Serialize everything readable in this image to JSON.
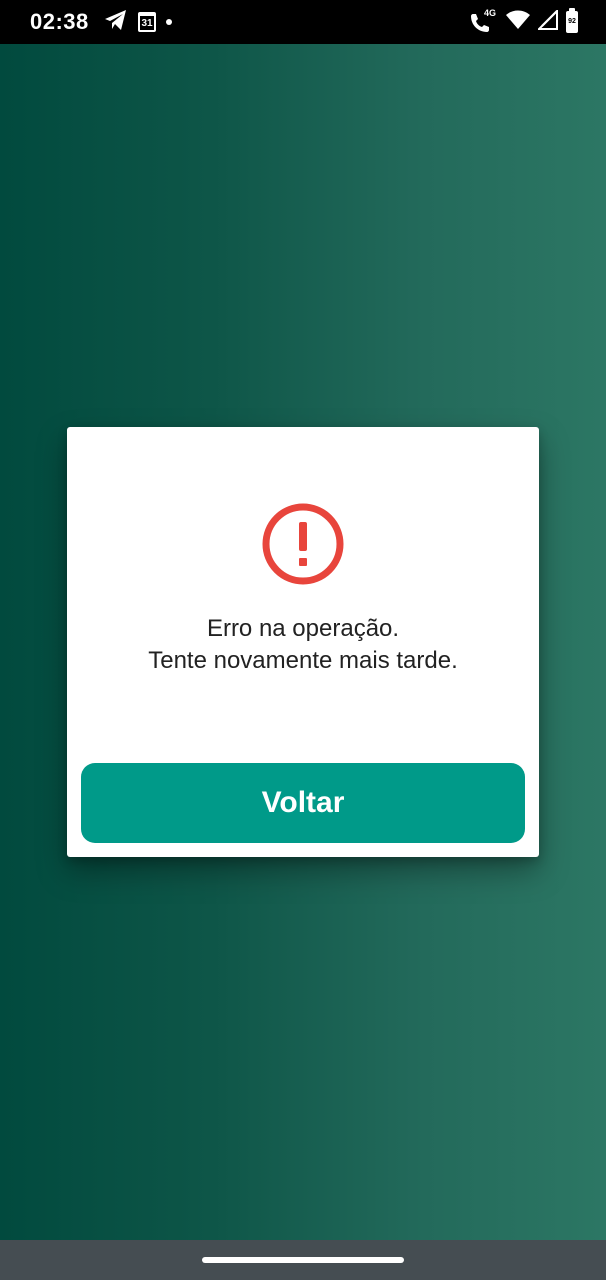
{
  "status_bar": {
    "time": "02:38",
    "calendar_day": "31",
    "network_type": "4G",
    "battery_level": "92",
    "icons": [
      "telegram-icon",
      "calendar-icon",
      "notification-dot",
      "wifi-call-icon",
      "wifi-icon",
      "signal-icon",
      "battery-icon"
    ]
  },
  "dialog": {
    "icon": "error-alert-icon",
    "message_line1": "Erro na operação.",
    "message_line2": "Tente novamente mais tarde.",
    "button_label": "Voltar"
  },
  "colors": {
    "background_gradient_start": "#014a3e",
    "background_gradient_end": "#2c7764",
    "error_red": "#e8453c",
    "button_teal": "#009a89",
    "nav_bar": "#454d52"
  }
}
